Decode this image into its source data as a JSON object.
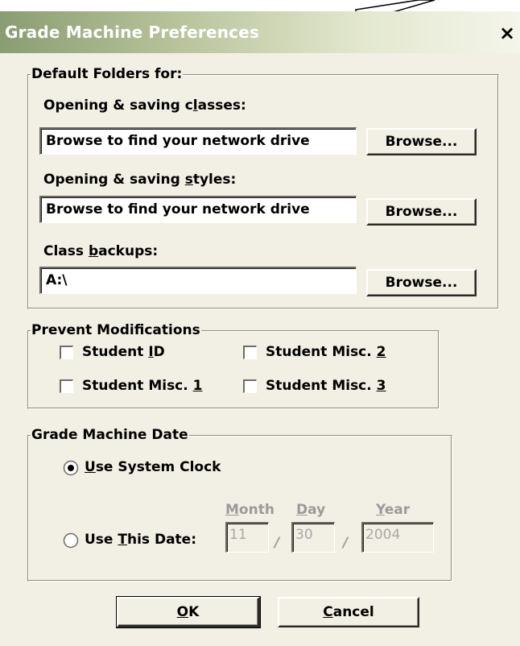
{
  "window": {
    "title": "Grade Machine Preferences",
    "close_glyph": "×"
  },
  "default_folders": {
    "legend": "Default Folders for:",
    "classes": {
      "label_pre": "Opening & saving c",
      "label_key": "l",
      "label_post": "asses:",
      "value": "Browse to find your network drive",
      "browse": "Browse..."
    },
    "styles": {
      "label_pre": "Opening & saving ",
      "label_key": "s",
      "label_post": "tyles:",
      "value": "Browse to find your network drive",
      "browse": "Browse..."
    },
    "backups": {
      "label_pre": "Class ",
      "label_key": "b",
      "label_post": "ackups:",
      "value": "A:\\",
      "browse": "Browse..."
    }
  },
  "prevent": {
    "legend": "Prevent Modifications",
    "student_id": {
      "pre": "Student ",
      "key": "I",
      "post": "D",
      "checked": false
    },
    "misc1": {
      "pre": "Student Misc. ",
      "key": "1",
      "post": "",
      "checked": false
    },
    "misc2": {
      "pre": "Student Misc. ",
      "key": "2",
      "post": "",
      "checked": false
    },
    "misc3": {
      "pre": "Student Misc. ",
      "key": "3",
      "post": "",
      "checked": false
    }
  },
  "date": {
    "legend": "Grade Machine Date",
    "system_clock": {
      "pre": "",
      "key": "U",
      "post": "se System Clock",
      "selected": true
    },
    "this_date": {
      "pre": "Use ",
      "key": "T",
      "post": "his Date:",
      "selected": false
    },
    "month_label": {
      "key": "M",
      "post": "onth"
    },
    "day_label": {
      "key": "D",
      "post": "ay"
    },
    "year_label": {
      "key": "Y",
      "post": "ear"
    },
    "month": "11",
    "day": "30",
    "year": "2004",
    "separator": "/"
  },
  "buttons": {
    "ok": {
      "key": "O",
      "post": "K"
    },
    "cancel": {
      "key": "C",
      "post": "ancel"
    }
  },
  "colors": {
    "titlebar_dark": "#8a9d72",
    "titlebar_light": "#f4f5ea",
    "face": "#f2f0e4",
    "disabled_text": "#9a9a9a"
  }
}
